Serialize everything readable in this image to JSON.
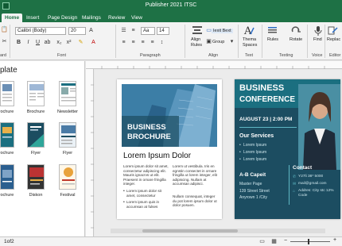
{
  "window": {
    "title": "Publisher 2021 ITSC"
  },
  "tabs": [
    "Home",
    "Insert",
    "Page Design",
    "Mailings",
    "Review",
    "View"
  ],
  "ribbon": {
    "font_name": "Calibri (Body)",
    "font_size": "20",
    "style_value": "Aa",
    "style_size": "14",
    "align_label": "Align Rules",
    "text_box_label": "Iexit Bext",
    "group_label": "Group",
    "theme_label": "Thema Spaces",
    "rules_label": "Rules",
    "rotate_label": "Rotate",
    "find_label": "Find",
    "replace_label": "Replac",
    "groups": {
      "clipboard": "ard",
      "font": "Font",
      "paragraph": "Paragraph",
      "align": "Align",
      "text": "Text",
      "texting": "Texting",
      "voice": "Voice",
      "editor": "Editor"
    }
  },
  "left_pane": {
    "header": "plate",
    "templates": [
      {
        "label": "rochure"
      },
      {
        "label": "Brochure"
      },
      {
        "label": "Newsletter"
      },
      {
        "label": "rochure"
      },
      {
        "label": "Flyer"
      },
      {
        "label": "Flyer"
      },
      {
        "label": "rochure"
      },
      {
        "label": "Diskon"
      },
      {
        "label": "Festival"
      }
    ]
  },
  "page_left": {
    "hero_title_1": "BUSINESS",
    "hero_title_2": "BROCHURE",
    "heading": "Lorem Ipsum Dolor",
    "col1": "Lorem ipsum dolor sit amet, consectetur adipiscing elit. Mauris ignacrvs ut elit. Praesent in ornare fringilla integer.",
    "col1_bullets": [
      "Lorem ipsum dolor sit amet, consectetur",
      "Lorem ipsum quis in accumsan at fulses"
    ],
    "col2": "Lorem ut vestibula. Iris en egnstin consectet in ornare fringilla ut lorem integer, elit adipiscing. Nullam at accumsan adipisci.",
    "col2b": "Nullam consequat, integer du pot lorem ipsum dolor ut dolor posuen."
  },
  "page_right": {
    "title_1": "BUSINESS",
    "title_2": "CONFERENCE",
    "date": "AUGUST 23 | 2:00 PM",
    "services_title": "Our Services",
    "services": [
      "Lorem Ipsum",
      "Lorem Ipsum",
      "Lorem Ipsum"
    ],
    "venue_title": "A-B Capeit",
    "venue_lines": [
      "Master Page",
      "139 Street Street",
      "Anyrown 1 /City"
    ],
    "contact_title": "Contact",
    "contact_lines": [
      "Y27li 38* 5000",
      "mail@gmail.com",
      "Addres: City stc 12% Code"
    ]
  },
  "status": {
    "page": "1of2"
  },
  "colors": {
    "brand": "#1e7145",
    "teal": "#1b6f80",
    "navy": "#1c4d61"
  }
}
